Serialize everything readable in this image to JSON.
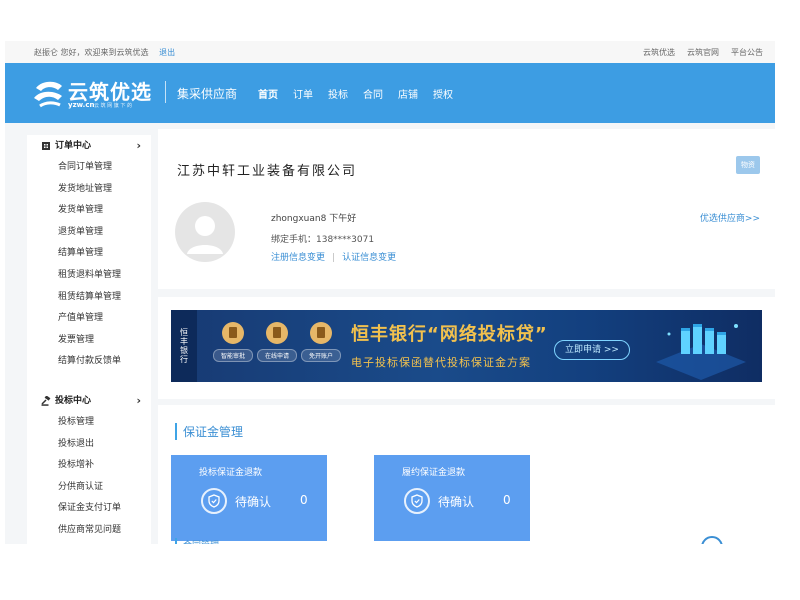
{
  "topbar": {
    "greeting": "赵振仑 您好，欢迎来到云筑优选",
    "logout": "退出",
    "links": [
      "云筑优选",
      "云筑官网",
      "平台公告"
    ]
  },
  "header": {
    "logo_name": "云筑优选",
    "logo_domain": "yzw.cn",
    "logo_tagline": "云 筑 网  旗 下 的",
    "portal_title": "集采供应商",
    "nav": [
      "首页",
      "订单",
      "投标",
      "合同",
      "店铺",
      "授权"
    ],
    "active_nav": "首页"
  },
  "sidebar": {
    "groups": [
      {
        "title": "订单中心",
        "icon": "building-icon",
        "items": [
          "合同订单管理",
          "发货地址管理",
          "发货单管理",
          "退货单管理",
          "结算单管理",
          "租赁退料单管理",
          "租赁结算单管理",
          "产值单管理",
          "发票管理",
          "结算付款反馈单"
        ]
      },
      {
        "title": "投标中心",
        "icon": "gavel-icon",
        "items": [
          "投标管理",
          "投标退出",
          "投标增补",
          "分供商认证",
          "保证金支付订单",
          "供应商常见问题"
        ]
      }
    ]
  },
  "company": {
    "name": "江苏中轩工业装备有限公司",
    "badge": "物资",
    "username_greeting": "zhongxuan8 下午好",
    "phone_line": "绑定手机：138****3071",
    "link_register": "注册信息变更",
    "link_auth": "认证信息变更",
    "preferred_link": "优选供应商>>"
  },
  "banner": {
    "bank": "恒丰银行",
    "features": [
      "智能审批",
      "在线申请",
      "免开账户"
    ],
    "title": "恒丰银行“网络投标贷”",
    "subtitle": "电子投标保函替代投标保证金方案",
    "cta": "立即申请 >>"
  },
  "deposit": {
    "section_title": "保证金管理",
    "boxes": [
      {
        "title": "投标保证金退款",
        "status": "待确认",
        "count": "0"
      },
      {
        "title": "履约保证金退款",
        "status": "待确认",
        "count": "0"
      }
    ],
    "next_section_title": "合同管理"
  },
  "colors": {
    "header_blue": "#3d9de3",
    "box_blue": "#5c9ef0",
    "link_blue": "#3b8fd4",
    "banner_gold": "#f2c14e"
  }
}
